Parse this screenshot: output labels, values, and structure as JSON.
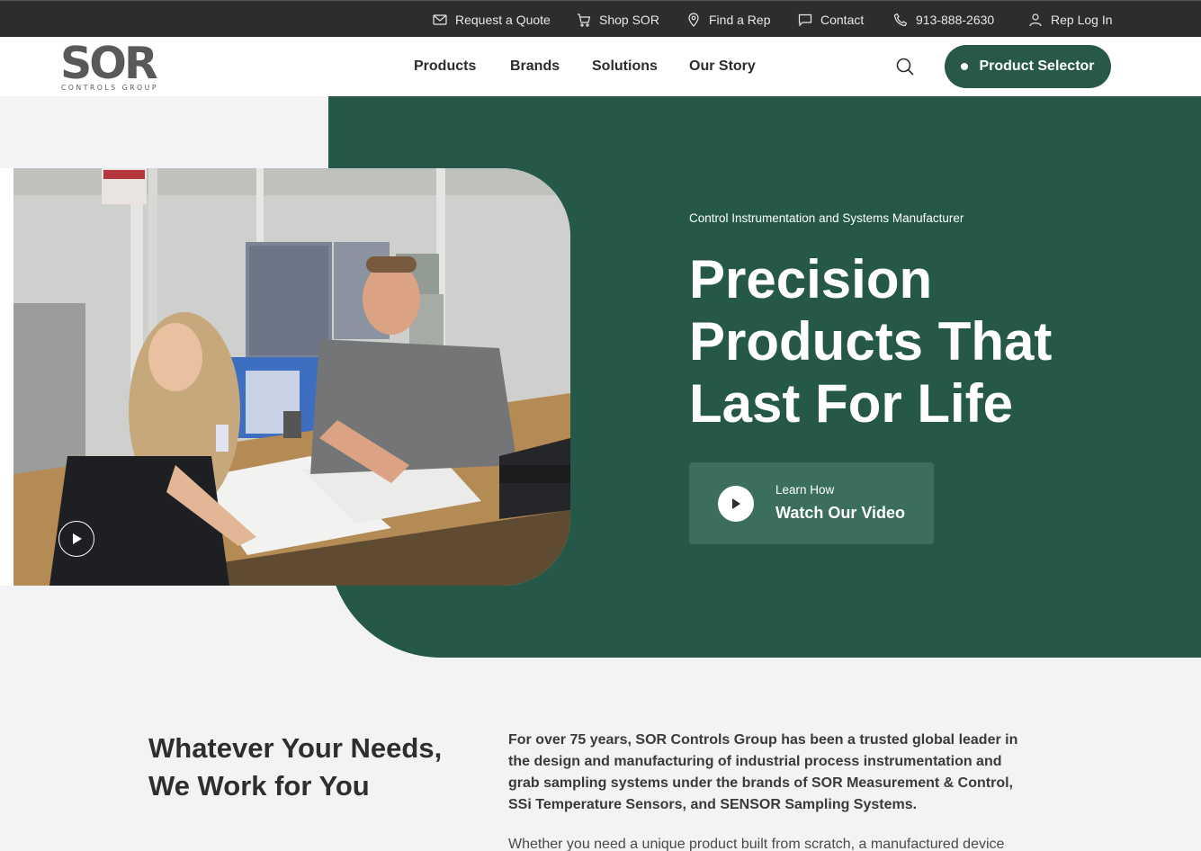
{
  "topbar": {
    "items": [
      {
        "label": "Request a Quote",
        "icon": "mail-icon"
      },
      {
        "label": "Shop SOR",
        "icon": "cart-icon"
      },
      {
        "label": "Find a Rep",
        "icon": "location-pin-icon"
      },
      {
        "label": "Contact",
        "icon": "chat-bubble-icon"
      },
      {
        "label": "913-888-2630",
        "icon": "phone-icon"
      },
      {
        "label": "Rep Log In",
        "icon": "user-icon"
      }
    ]
  },
  "header": {
    "logo": {
      "main": "SOR",
      "sub": "CONTROLS GROUP"
    },
    "nav": [
      {
        "label": "Products"
      },
      {
        "label": "Brands"
      },
      {
        "label": "Solutions"
      },
      {
        "label": "Our Story"
      }
    ],
    "search_icon": "search-icon",
    "selector_label": "Product Selector"
  },
  "hero": {
    "eyebrow": "Control Instrumentation and Systems Manufacturer",
    "headline": "Precision Products That Last For Life",
    "video": {
      "small": "Learn How",
      "big": "Watch Our Video",
      "icon": "play-icon"
    }
  },
  "intro": {
    "title": "Whatever Your Needs, We Work for You",
    "lead": "For over 75 years, SOR Controls Group has been a trusted global leader in the design and manufacturing of industrial process instrumentation and grab sampling systems under the brands of SOR Measurement & Control, SSi Temperature Sensors, and SENSOR Sampling Systems.",
    "body": "Whether you need a unique product built from scratch, a manufactured device"
  },
  "colors": {
    "brand_green": "#26584a",
    "card_green": "#3b6e5f",
    "topbar": "#2d2d2f",
    "page_bg": "#f3f3f5"
  }
}
